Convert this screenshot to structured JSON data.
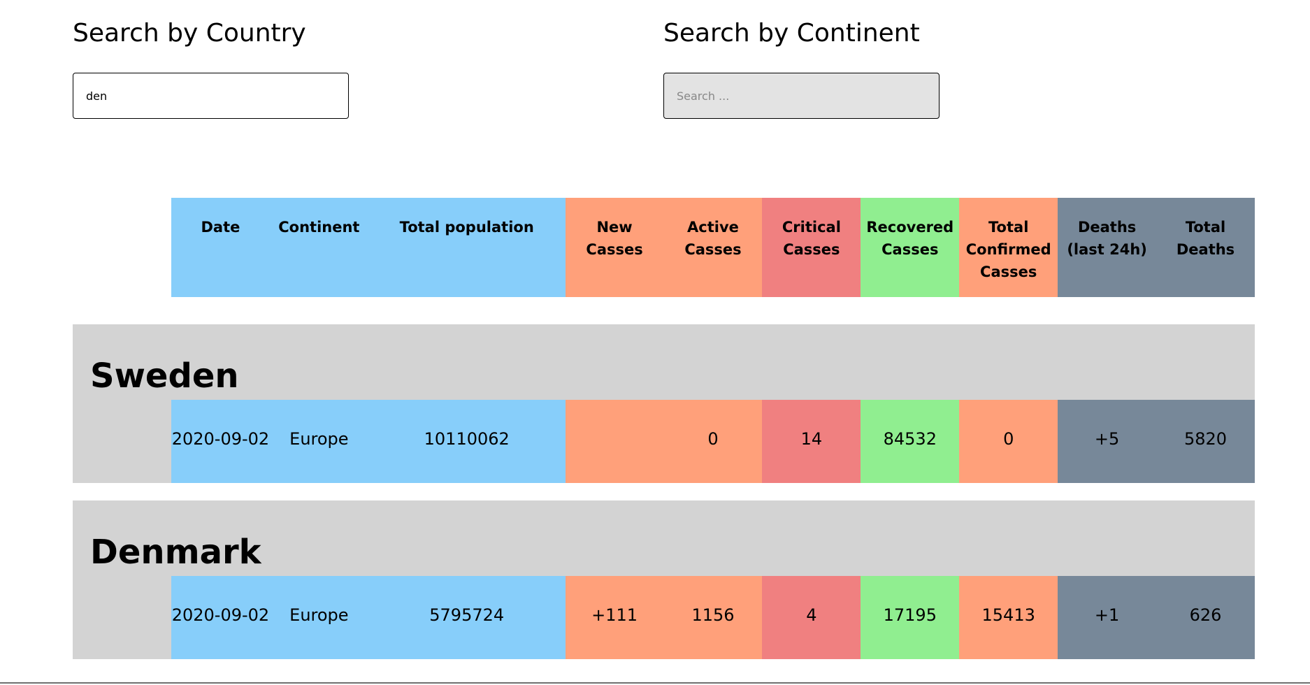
{
  "search": {
    "country": {
      "title": "Search by Country",
      "value": "den",
      "placeholder": ""
    },
    "continent": {
      "title": "Search by Continent",
      "value": "",
      "placeholder": "Search ..."
    }
  },
  "table": {
    "headers": [
      "Date",
      "Continent",
      "Total population",
      "New Casses",
      "Active Casses",
      "Critical Casses",
      "Recovered Casses",
      "Total Confirmed Casses",
      "Deaths (last 24h)",
      "Total Deaths"
    ],
    "countries": [
      {
        "name": "Sweden",
        "date": "2020-09-02",
        "continent": "Europe",
        "population": "10110062",
        "new_cases": "",
        "active_cases": "0",
        "critical_cases": "14",
        "recovered_cases": "84532",
        "total_confirmed": "0",
        "deaths_24h": "+5",
        "total_deaths": "5820"
      },
      {
        "name": "Denmark",
        "date": "2020-09-02",
        "continent": "Europe",
        "population": "5795724",
        "new_cases": "+111",
        "active_cases": "1156",
        "critical_cases": "4",
        "recovered_cases": "17195",
        "total_confirmed": "15413",
        "deaths_24h": "+1",
        "total_deaths": "626"
      }
    ]
  },
  "colors": {
    "blue": "#87cefa",
    "orange": "#ffa07a",
    "red": "#f08080",
    "green": "#90ee90",
    "slate": "#778899",
    "card_background": "#d3d3d3"
  }
}
